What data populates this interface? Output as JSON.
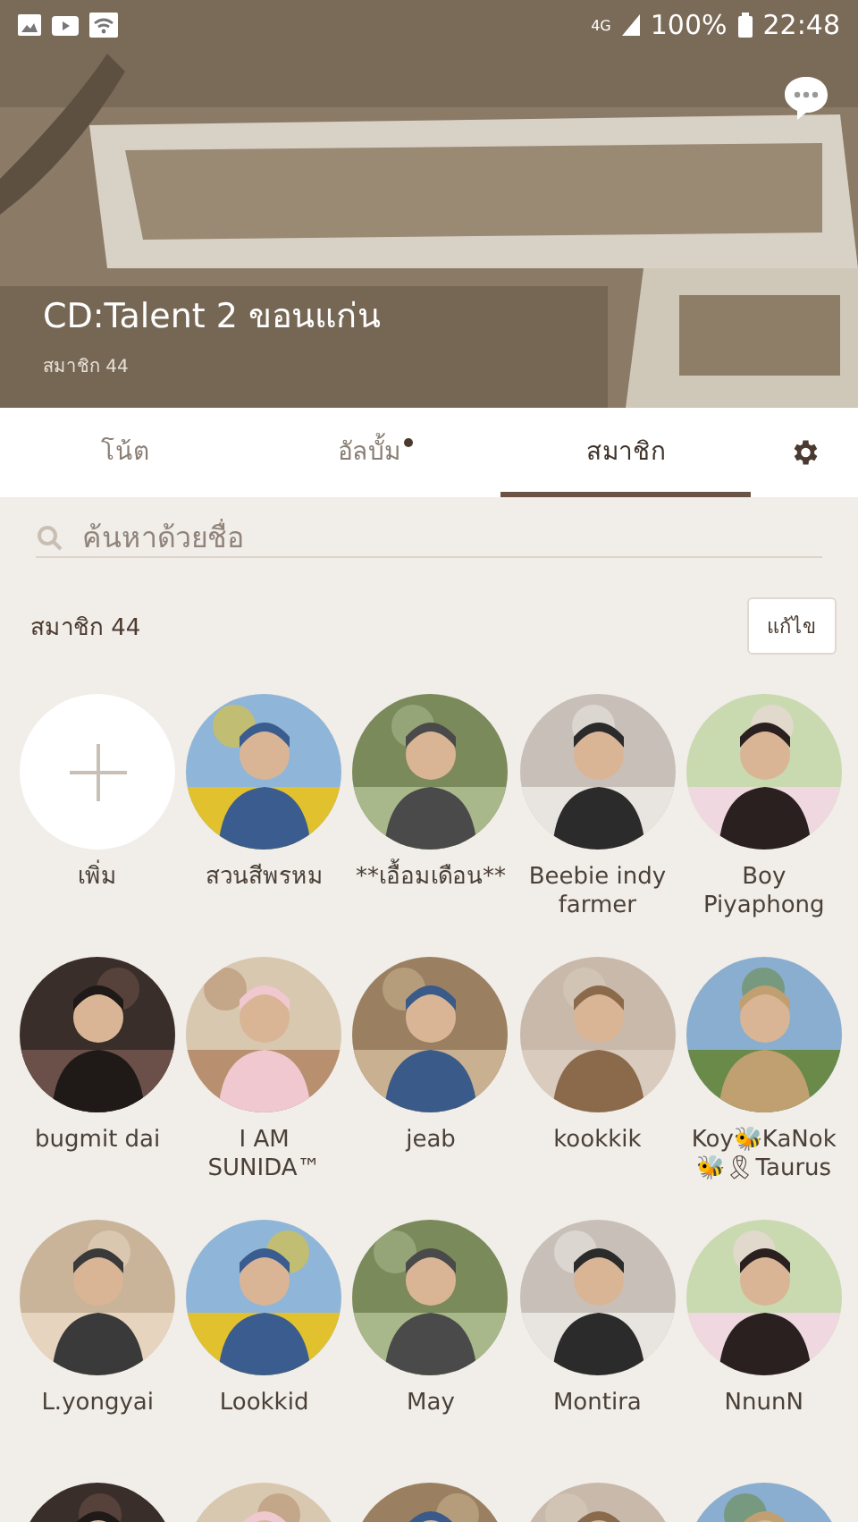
{
  "status_bar": {
    "network": "4G",
    "battery": "100%",
    "time": "22:48"
  },
  "header": {
    "kind": "picture",
    "title": "CD:Talent 2 ขอนแก่น",
    "subtitle": "สมาชิก 44"
  },
  "tabs": [
    {
      "label": "โน้ต",
      "selected": false,
      "has_new": false
    },
    {
      "label": "อัลบั้ม",
      "selected": false,
      "has_new": true
    },
    {
      "label": "สมาชิก",
      "selected": true,
      "has_new": false
    }
  ],
  "search": {
    "placeholder": "ค้นหาด้วยชื่อ"
  },
  "members_header": {
    "title": "สมาชิก 44",
    "edit_button": "แก้ไข"
  },
  "members": [
    {
      "kind": "add",
      "name": "เพิ่ม"
    },
    {
      "kind": "picture",
      "name": "สวนสีพรหม"
    },
    {
      "kind": "picture",
      "name": "**เอื้อมเดือน**"
    },
    {
      "kind": "picture",
      "name": "Beebie indy farmer"
    },
    {
      "kind": "picture",
      "name": "Boy Piyaphong"
    },
    {
      "kind": "picture",
      "name": "bugmit dai"
    },
    {
      "kind": "picture",
      "name": "I AM SUNIDA™"
    },
    {
      "kind": "picture",
      "name": "jeab"
    },
    {
      "kind": "picture",
      "name": "kookkik"
    },
    {
      "kind": "picture",
      "name": "Koy🐝KaNok 🐝🎗Taurus"
    },
    {
      "kind": "picture",
      "name": "L.yongyai"
    },
    {
      "kind": "picture",
      "name": "Lookkid"
    },
    {
      "kind": "picture",
      "name": "May"
    },
    {
      "kind": "picture",
      "name": "Montira"
    },
    {
      "kind": "picture",
      "name": "NnunN"
    },
    {
      "kind": "picture"
    },
    {
      "kind": "picture"
    },
    {
      "kind": "picture"
    },
    {
      "kind": "picture"
    },
    {
      "kind": "picture"
    }
  ]
}
